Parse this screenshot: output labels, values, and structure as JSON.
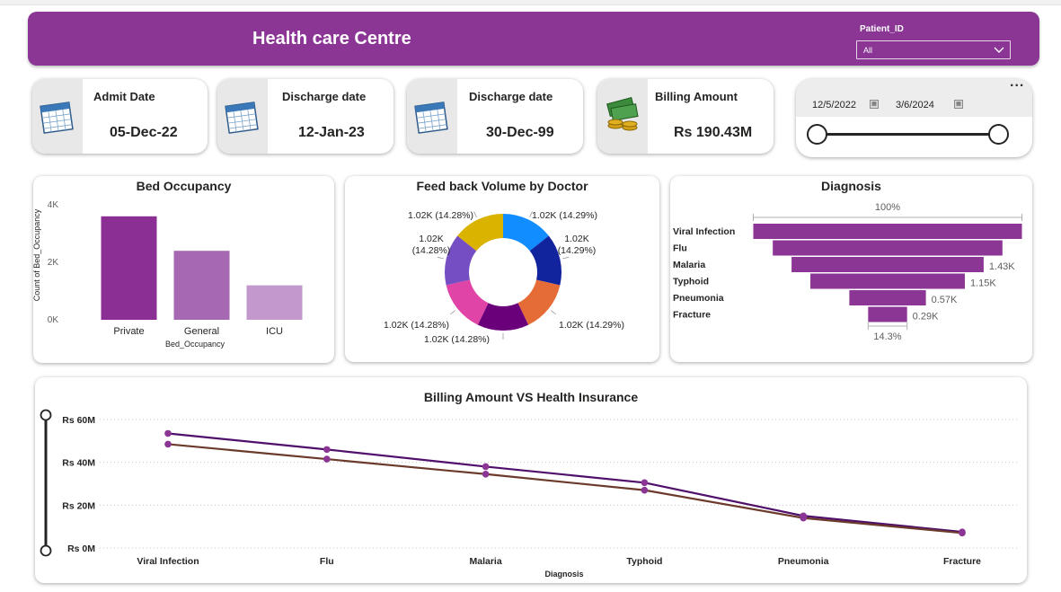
{
  "header": {
    "title": "Health care Centre",
    "slicer_label": "Patient_ID",
    "slicer_value": "All"
  },
  "cards": [
    {
      "label": "Admit Date",
      "value": "05-Dec-22",
      "icon": "calendar-icon"
    },
    {
      "label": "Discharge date",
      "value": "12-Jan-23",
      "icon": "calendar-icon"
    },
    {
      "label": "Discharge date",
      "value": "30-Dec-99",
      "icon": "calendar-icon"
    },
    {
      "label": "Billing Amount",
      "value": "Rs 190.43M",
      "icon": "money-icon"
    }
  ],
  "date_slicer": {
    "start": "12/5/2022",
    "end": "3/6/2024",
    "range": [
      0,
      1
    ]
  },
  "more_options": "...",
  "colors": {
    "brand": "#8b3595",
    "bar_private": "#8b2f95",
    "bar_general": "#a668b2",
    "bar_icu": "#c399cd",
    "line_series_1": "#4f0f6a",
    "line_series_2": "#6b3a2a",
    "line_points": "#8b3595"
  },
  "chart_data": [
    {
      "type": "bar",
      "title": "Bed Occupancy",
      "xlabel": "Bed_Occupancy",
      "ylabel": "Count of Bed_Occupancy",
      "categories": [
        "Private",
        "General",
        "ICU"
      ],
      "values": [
        3600,
        2400,
        1200
      ],
      "ylim": [
        0,
        4000
      ],
      "yticks": [
        "0K",
        "2K",
        "4K"
      ],
      "ytick_values": [
        0,
        2000,
        4000
      ]
    },
    {
      "type": "pie",
      "title": "Feed back Volume by Doctor",
      "values": [
        1020,
        1020,
        1020,
        1020,
        1020,
        1020,
        1020
      ],
      "colors": [
        "#118dff",
        "#12239e",
        "#e66c37",
        "#6b007b",
        "#e044a7",
        "#744ec2",
        "#d9b300"
      ],
      "labels": [
        "1.02K (14.29%)",
        "1.02K (14.29%)",
        "1.02K (14.29%)",
        "1.02K (14.28%)",
        "1.02K (14.28%)",
        "1.02K (14.28%)",
        "1.02K (14.28%)"
      ]
    },
    {
      "type": "bar",
      "title": "Diagnosis",
      "categories": [
        "Viral Infection",
        "Flu",
        "Malaria",
        "Typhoid",
        "Pneumonia",
        "Fracture"
      ],
      "values": [
        2000,
        1710,
        1430,
        1150,
        570,
        290
      ],
      "labels": [
        "",
        "",
        "1.43K",
        "1.15K",
        "0.57K",
        "0.29K"
      ],
      "top_label": "100%",
      "bottom_label": "14.3%"
    },
    {
      "type": "line",
      "title": "Billing Amount VS Health Insurance",
      "xlabel": "Diagnosis",
      "categories": [
        "Viral Infection",
        "Flu",
        "Malaria",
        "Typhoid",
        "Pneumonia",
        "Fracture"
      ],
      "series": [
        {
          "values": [
            53.5,
            46.0,
            38.0,
            30.5,
            15.0,
            7.5
          ]
        },
        {
          "values": [
            48.5,
            41.5,
            34.5,
            27.0,
            14.0,
            7.0
          ]
        }
      ],
      "ylim": [
        0,
        60
      ],
      "yticks": [
        "Rs 0M",
        "Rs 20M",
        "Rs 40M",
        "Rs 60M"
      ],
      "ytick_values": [
        0,
        20,
        40,
        60
      ]
    }
  ]
}
